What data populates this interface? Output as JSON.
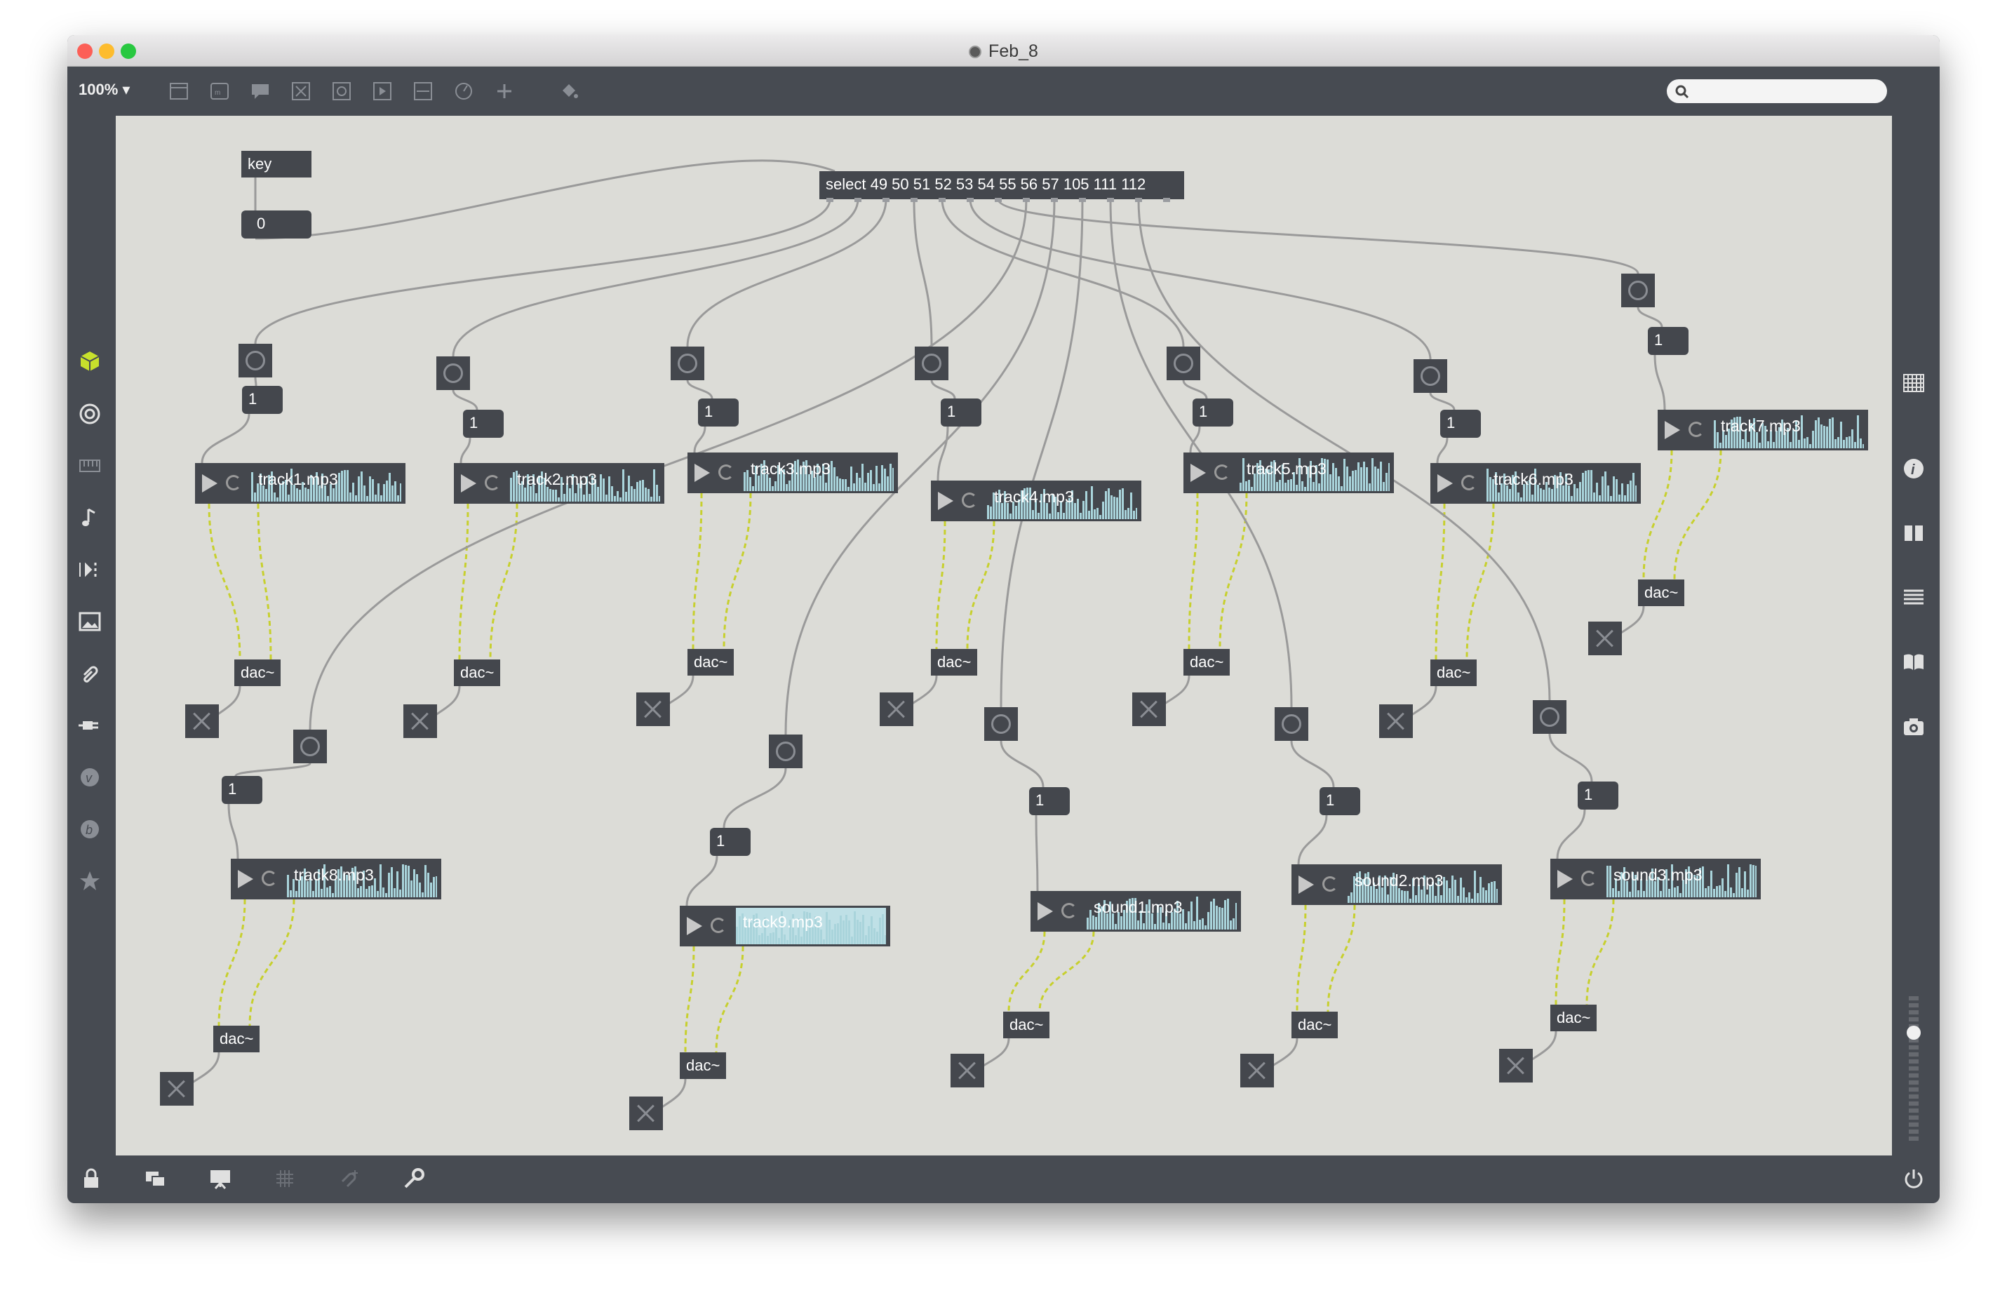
{
  "window": {
    "title": "Feb_8",
    "traffic_lights": {
      "close": "#fc5f57",
      "minimize": "#fdbc2e",
      "zoom": "#28c840"
    }
  },
  "toolbar": {
    "zoom_label": "100%",
    "icons": [
      "new-object-icon",
      "message-icon",
      "comment-icon",
      "toggle-object-icon",
      "bang-object-icon",
      "playbar-icon",
      "slider-icon",
      "dial-icon",
      "add-icon",
      "paint-bucket-icon"
    ],
    "search_placeholder": ""
  },
  "left_sidebar": [
    "packages-cube-icon",
    "target-icon",
    "keyboard-icon",
    "music-note-icon",
    "sequencer-icon",
    "image-icon",
    "paperclip-icon",
    "plug-icon",
    "vst-icon",
    "bach-icon",
    "star-icon"
  ],
  "right_sidebar": [
    "grid-icon",
    "info-icon",
    "columns-icon",
    "list-icon",
    "book-icon",
    "camera-icon",
    "volume-slider",
    "power-icon"
  ],
  "bottom_bar": [
    "lock-icon",
    "presentation-windows-icon",
    "presentation-icon",
    "grid-snap-icon",
    "object-paperclip-icon",
    "wrench-icon"
  ],
  "colors": {
    "window_frame": "#474b52",
    "patcher_bg": "#dcdcd7",
    "object_bg": "#44474d",
    "cord_gray": "#9a9a9a",
    "signal_cord": "#c7d02e",
    "accent_green": "#c7e02c",
    "waveform": "#a9d4db"
  },
  "patch": {
    "key_object": "key",
    "key_number": "0",
    "select_object": "select 49 50 51 52 53 54 55 56 57 105 111 112",
    "message_value": "1",
    "dac_label": "dac~",
    "players": [
      {
        "id": "track1",
        "file": "track1.mp3"
      },
      {
        "id": "track2",
        "file": "track2.mp3"
      },
      {
        "id": "track3",
        "file": "track3.mp3"
      },
      {
        "id": "track4",
        "file": "track4.mp3"
      },
      {
        "id": "track5",
        "file": "track5.mp3"
      },
      {
        "id": "track6",
        "file": "track6.mp3"
      },
      {
        "id": "track7",
        "file": "track7.mp3"
      },
      {
        "id": "track8",
        "file": "track8.mp3"
      },
      {
        "id": "track9",
        "file": "track9.mp3"
      },
      {
        "id": "sound1",
        "file": "sound1.mp3"
      },
      {
        "id": "sound2",
        "file": "sound2.mp3"
      },
      {
        "id": "sound3",
        "file": "sound3.mp3"
      }
    ]
  }
}
